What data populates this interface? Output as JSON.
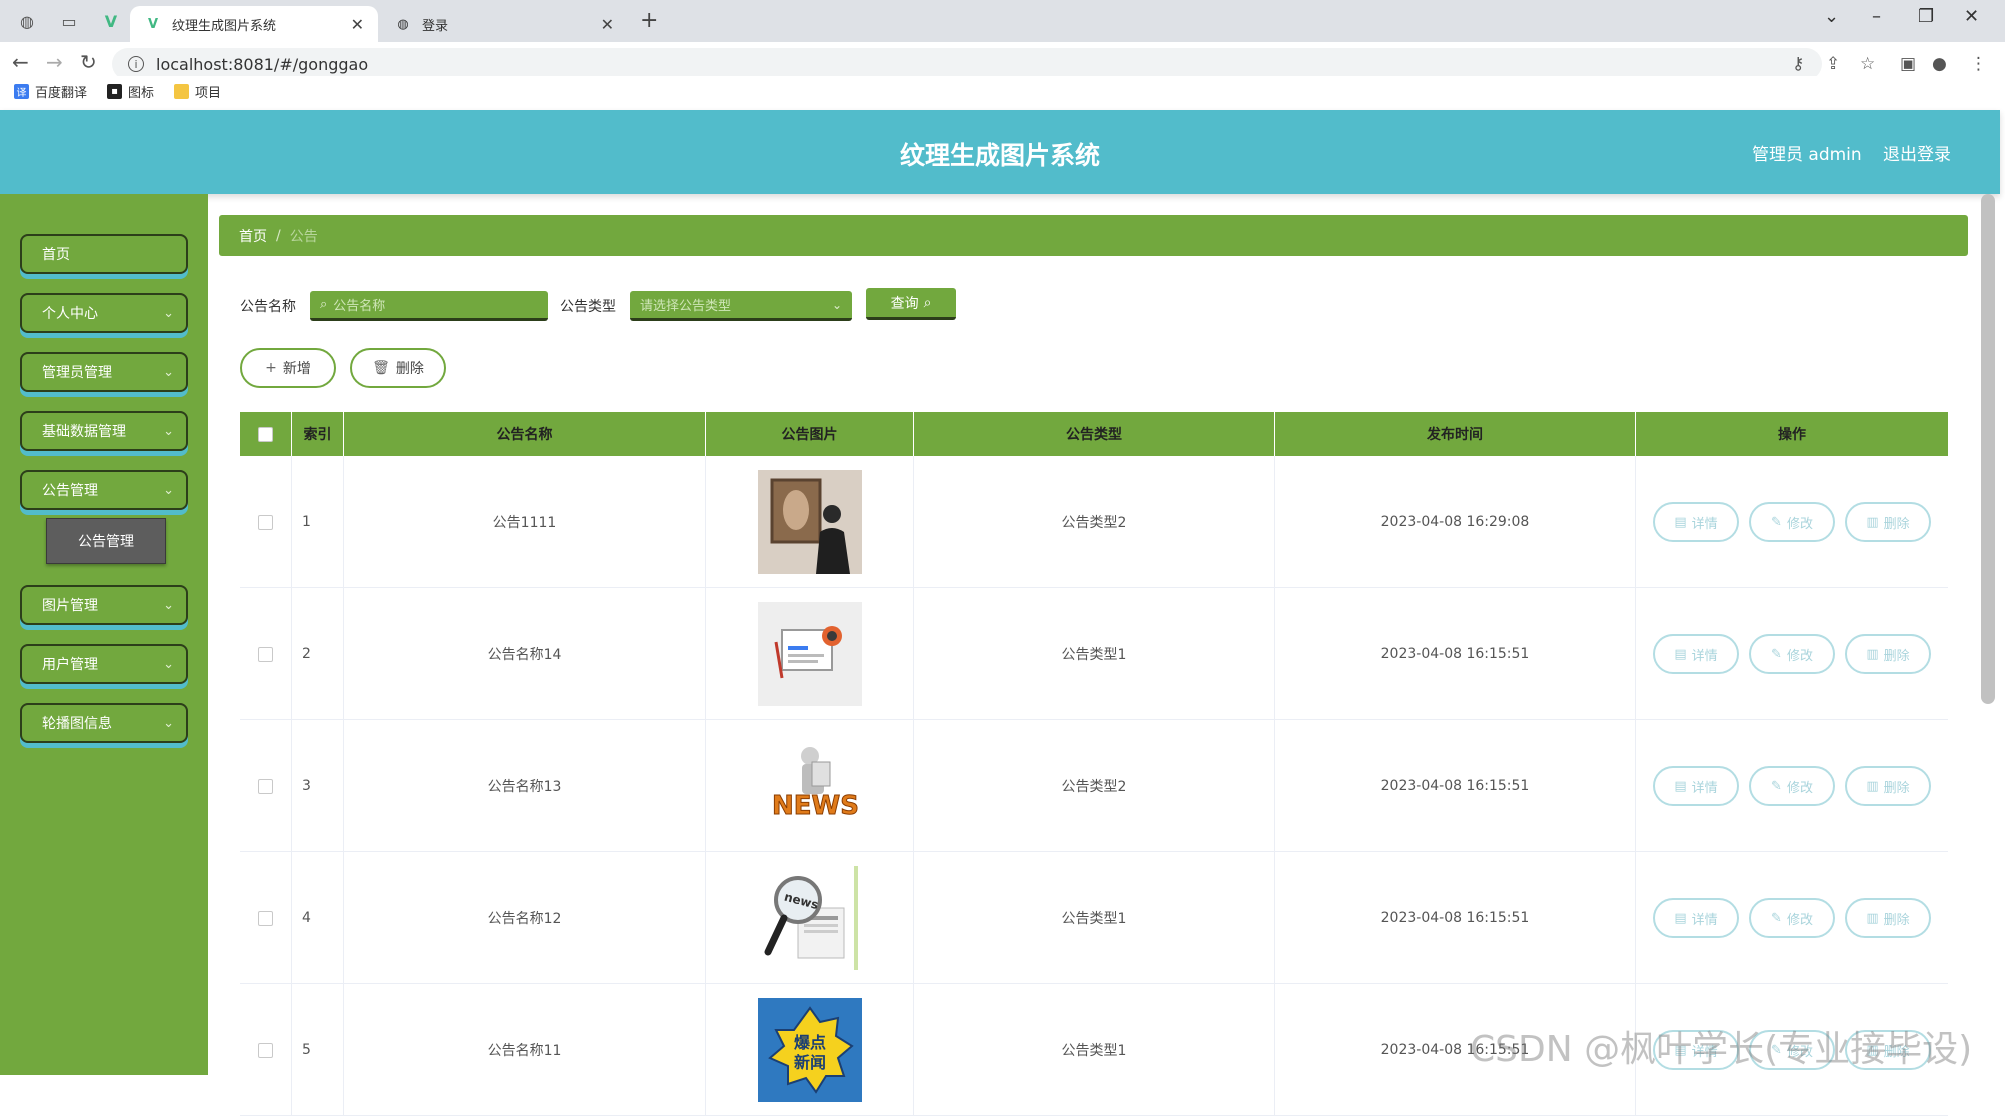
{
  "browser": {
    "tabs": [
      {
        "title": "纹理生成图片系统",
        "active": true
      },
      {
        "title": "登录",
        "active": false
      }
    ],
    "url": "localhost:8081/#/gonggao",
    "bookmarks": [
      {
        "label": "百度翻译",
        "icon": "translate-icon",
        "color": "#3b7cf0"
      },
      {
        "label": "图标",
        "icon": "image-icon",
        "color": "#222222"
      },
      {
        "label": "项目",
        "icon": "folder-icon",
        "color": "#f4c542"
      }
    ]
  },
  "header": {
    "title": "纹理生成图片系统",
    "admin": "管理员 admin",
    "logout": "退出登录"
  },
  "sidebar": {
    "items": [
      {
        "label": "首页",
        "has_children": false
      },
      {
        "label": "个人中心",
        "has_children": true
      },
      {
        "label": "管理员管理",
        "has_children": true
      },
      {
        "label": "基础数据管理",
        "has_children": true
      },
      {
        "label": "公告管理",
        "has_children": true
      },
      {
        "label": "图片管理",
        "has_children": true
      },
      {
        "label": "用户管理",
        "has_children": true
      },
      {
        "label": "轮播图信息",
        "has_children": true
      }
    ],
    "submenu": {
      "label": "公告管理"
    }
  },
  "breadcrumb": {
    "home": "首页",
    "separator": "/",
    "current": "公告"
  },
  "search": {
    "name_label": "公告名称",
    "name_placeholder": "公告名称",
    "type_label": "公告类型",
    "type_placeholder": "请选择公告类型",
    "query_button": "查询"
  },
  "actions": {
    "add": "新增",
    "delete": "删除"
  },
  "table": {
    "headers": [
      "索引",
      "公告名称",
      "公告图片",
      "公告类型",
      "发布时间",
      "操作"
    ],
    "row_actions": {
      "detail": "详情",
      "edit": "修改",
      "delete": "删除"
    },
    "rows": [
      {
        "index": "1",
        "name": "公告1111",
        "image": "person-with-painting",
        "type": "公告类型2",
        "time": "2023-04-08 16:29:08"
      },
      {
        "index": "2",
        "name": "公告名称14",
        "image": "news-icon",
        "type": "公告类型1",
        "time": "2023-04-08 16:15:51"
      },
      {
        "index": "3",
        "name": "公告名称13",
        "image": "news-figure",
        "type": "公告类型2",
        "time": "2023-04-08 16:15:51"
      },
      {
        "index": "4",
        "name": "公告名称12",
        "image": "magnifier-news",
        "type": "公告类型1",
        "time": "2023-04-08 16:15:51"
      },
      {
        "index": "5",
        "name": "公告名称11",
        "image": "hot-news-badge",
        "type": "公告类型1",
        "time": "2023-04-08 16:15:51"
      }
    ]
  },
  "watermark": "CSDN @枫叶学长(专业接毕设)",
  "colors": {
    "header": "#52bccb",
    "sidebar": "#72a83e",
    "accent_dark": "#2c3e1a",
    "op_button": "#b3dde3"
  }
}
